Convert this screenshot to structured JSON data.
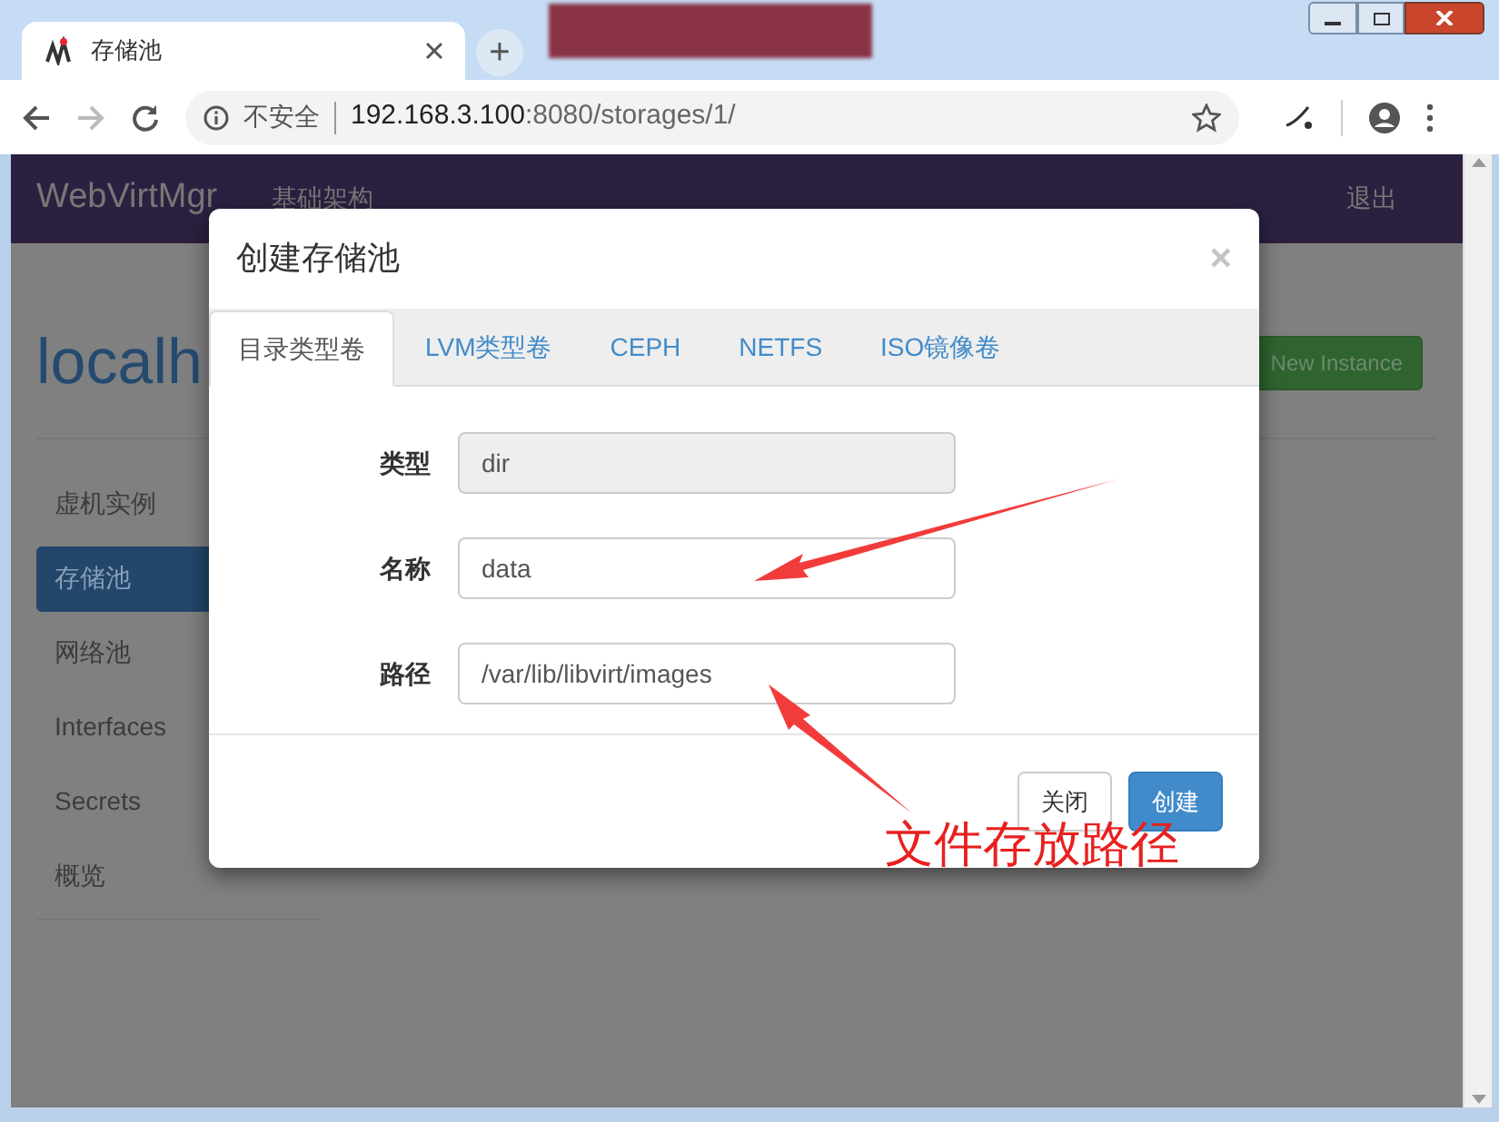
{
  "browser": {
    "tab_title": "存储池",
    "new_tab": "+",
    "security": "不安全",
    "url_host": "192.168.3.100",
    "url_rest": ":8080/storages/1/"
  },
  "page": {
    "brand": "WebVirtMgr",
    "nav_link": "基础架构",
    "logout": "退出",
    "heading": "localh",
    "new_instance": "New Instance",
    "sidebar": [
      {
        "label": "虚机实例",
        "selected": false
      },
      {
        "label": "存储池",
        "selected": true
      },
      {
        "label": "网络池",
        "selected": false
      },
      {
        "label": "Interfaces",
        "selected": false
      },
      {
        "label": "Secrets",
        "selected": false
      },
      {
        "label": "概览",
        "selected": false
      }
    ]
  },
  "modal": {
    "title": "创建存储池",
    "close": "×",
    "tabs": [
      {
        "label": "目录类型卷",
        "selected": true
      },
      {
        "label": "LVM类型卷",
        "selected": false
      },
      {
        "label": "CEPH",
        "selected": false
      },
      {
        "label": "NETFS",
        "selected": false
      },
      {
        "label": "ISO镜像卷",
        "selected": false
      }
    ],
    "fields": [
      {
        "label": "类型",
        "value": "dir",
        "disabled": true
      },
      {
        "label": "名称",
        "value": "data",
        "disabled": false
      },
      {
        "label": "路径",
        "value": "/var/lib/libvirt/images",
        "disabled": false
      }
    ],
    "buttons": [
      {
        "label": "关闭",
        "kind": "default"
      },
      {
        "label": "创建",
        "kind": "primary"
      }
    ]
  },
  "annotation": {
    "text": "文件存放路径"
  }
}
